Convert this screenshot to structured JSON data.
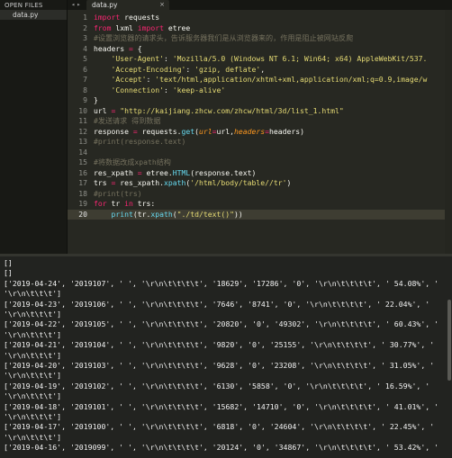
{
  "sidebar": {
    "title": "OPEN FILES",
    "files": [
      "data.py"
    ]
  },
  "tabs": {
    "nav_icon": "tab-nav-arrows",
    "items": [
      {
        "label": "data.py",
        "close": "×"
      }
    ]
  },
  "editor": {
    "current_line": 20,
    "lines": [
      {
        "n": "1",
        "code": [
          [
            "kw",
            "import"
          ],
          [
            "nm",
            " requests"
          ]
        ]
      },
      {
        "n": "2",
        "code": [
          [
            "kw",
            "from"
          ],
          [
            "nm",
            " lxml "
          ],
          [
            "kw",
            "import"
          ],
          [
            "nm",
            " etree"
          ]
        ]
      },
      {
        "n": "3",
        "code": [
          [
            "cm",
            "#设置浏览器的请求头，告诉服务器我们是从浏览器来的，作用是阻止被网站反爬"
          ]
        ]
      },
      {
        "n": "4",
        "code": [
          [
            "nm",
            "headers "
          ],
          [
            "kw",
            "="
          ],
          [
            "nm",
            " {"
          ]
        ]
      },
      {
        "n": "5",
        "code": [
          [
            "nm",
            "    "
          ],
          [
            "st",
            "'User-Agent'"
          ],
          [
            "nm",
            ": "
          ],
          [
            "st",
            "'Mozilla/5.0 (Windows NT 6.1; Win64; x64) AppleWebKit/537."
          ]
        ]
      },
      {
        "n": "6",
        "code": [
          [
            "nm",
            "    "
          ],
          [
            "st",
            "'Accept-Encoding'"
          ],
          [
            "nm",
            ": "
          ],
          [
            "st",
            "'gzip, deflate'"
          ],
          [
            "nm",
            ","
          ]
        ]
      },
      {
        "n": "7",
        "code": [
          [
            "nm",
            "    "
          ],
          [
            "st",
            "'Accept'"
          ],
          [
            "nm",
            ": "
          ],
          [
            "st",
            "'text/html,application/xhtml+xml,application/xml;q=0.9,image/w"
          ]
        ]
      },
      {
        "n": "8",
        "code": [
          [
            "nm",
            "    "
          ],
          [
            "st",
            "'Connection'"
          ],
          [
            "nm",
            ": "
          ],
          [
            "st",
            "'keep-alive'"
          ]
        ]
      },
      {
        "n": "9",
        "code": [
          [
            "nm",
            "}"
          ]
        ]
      },
      {
        "n": "10",
        "code": [
          [
            "nm",
            "url "
          ],
          [
            "kw",
            "="
          ],
          [
            "nm",
            " "
          ],
          [
            "st",
            "\"http://kaijiang.zhcw.com/zhcw/html/3d/list_1.html\""
          ]
        ]
      },
      {
        "n": "11",
        "code": [
          [
            "cm",
            "#发送请求 得到数据"
          ]
        ]
      },
      {
        "n": "12",
        "code": [
          [
            "nm",
            "response "
          ],
          [
            "kw",
            "="
          ],
          [
            "nm",
            " requests."
          ],
          [
            "bi",
            "get"
          ],
          [
            "nm",
            "("
          ],
          [
            "pa",
            "url"
          ],
          [
            "kw",
            "="
          ],
          [
            "nm",
            "url,"
          ],
          [
            "pa",
            "headers"
          ],
          [
            "kw",
            "="
          ],
          [
            "nm",
            "headers)"
          ]
        ]
      },
      {
        "n": "13",
        "code": [
          [
            "cm",
            "#print(response.text)"
          ]
        ]
      },
      {
        "n": "14",
        "code": [
          [
            "nm",
            ""
          ]
        ]
      },
      {
        "n": "15",
        "code": [
          [
            "cm",
            "#将数据改成xpath结构"
          ]
        ]
      },
      {
        "n": "16",
        "code": [
          [
            "nm",
            "res_xpath "
          ],
          [
            "kw",
            "="
          ],
          [
            "nm",
            " etree."
          ],
          [
            "bi",
            "HTML"
          ],
          [
            "nm",
            "(response.text)"
          ]
        ]
      },
      {
        "n": "17",
        "code": [
          [
            "nm",
            "trs "
          ],
          [
            "kw",
            "="
          ],
          [
            "nm",
            " res_xpath."
          ],
          [
            "bi",
            "xpath"
          ],
          [
            "nm",
            "("
          ],
          [
            "st",
            "'/html/body/table//tr'"
          ],
          [
            "nm",
            ")"
          ]
        ]
      },
      {
        "n": "18",
        "code": [
          [
            "cm",
            "#print(trs)"
          ]
        ]
      },
      {
        "n": "19",
        "code": [
          [
            "kw",
            "for"
          ],
          [
            "nm",
            " tr "
          ],
          [
            "kw",
            "in"
          ],
          [
            "nm",
            " trs:"
          ]
        ]
      },
      {
        "n": "20",
        "code": [
          [
            "nm",
            "    "
          ],
          [
            "bi",
            "print"
          ],
          [
            "nm",
            "(tr."
          ],
          [
            "bi",
            "xpath"
          ],
          [
            "nm",
            "("
          ],
          [
            "st",
            "\"./td/text()\""
          ],
          [
            "nm",
            "))"
          ]
        ]
      }
    ]
  },
  "console": {
    "lines": [
      "[]",
      "[]",
      "['2019-04-24', '2019107', ' ', '\\r\\n\\t\\t\\t\\t', '18629', '17286', '0', '\\r\\n\\t\\t\\t\\t', ' 54.08%', '",
      "'\\r\\n\\t\\t\\t']",
      "['2019-04-23', '2019106', ' ', '\\r\\n\\t\\t\\t\\t', '7646', '8741', '0', '\\r\\n\\t\\t\\t\\t', ' 22.04%', '",
      "'\\r\\n\\t\\t\\t']",
      "['2019-04-22', '2019105', ' ', '\\r\\n\\t\\t\\t\\t', '20820', '0', '49302', '\\r\\n\\t\\t\\t\\t', ' 60.43%', '",
      "'\\r\\n\\t\\t\\t']",
      "['2019-04-21', '2019104', ' ', '\\r\\n\\t\\t\\t\\t', '9820', '0', '25155', '\\r\\n\\t\\t\\t\\t', ' 30.77%', '",
      "'\\r\\n\\t\\t\\t']",
      "['2019-04-20', '2019103', ' ', '\\r\\n\\t\\t\\t\\t', '9628', '0', '23208', '\\r\\n\\t\\t\\t\\t', ' 31.05%', '",
      "'\\r\\n\\t\\t\\t']",
      "['2019-04-19', '2019102', ' ', '\\r\\n\\t\\t\\t\\t', '6130', '5858', '0', '\\r\\n\\t\\t\\t\\t', ' 16.59%', '",
      "'\\r\\n\\t\\t\\t']",
      "['2019-04-18', '2019101', ' ', '\\r\\n\\t\\t\\t\\t', '15682', '14710', '0', '\\r\\n\\t\\t\\t\\t', ' 41.01%', '",
      "'\\r\\n\\t\\t\\t']",
      "['2019-04-17', '2019100', ' ', '\\r\\n\\t\\t\\t\\t', '6818', '0', '24604', '\\r\\n\\t\\t\\t\\t', ' 22.45%', '",
      "'\\r\\n\\t\\t\\t']",
      "['2019-04-16', '2019099', ' ', '\\r\\n\\t\\t\\t\\t', '20124', '0', '34867', '\\r\\n\\t\\t\\t\\t', ' 53.42%', '"
    ]
  }
}
